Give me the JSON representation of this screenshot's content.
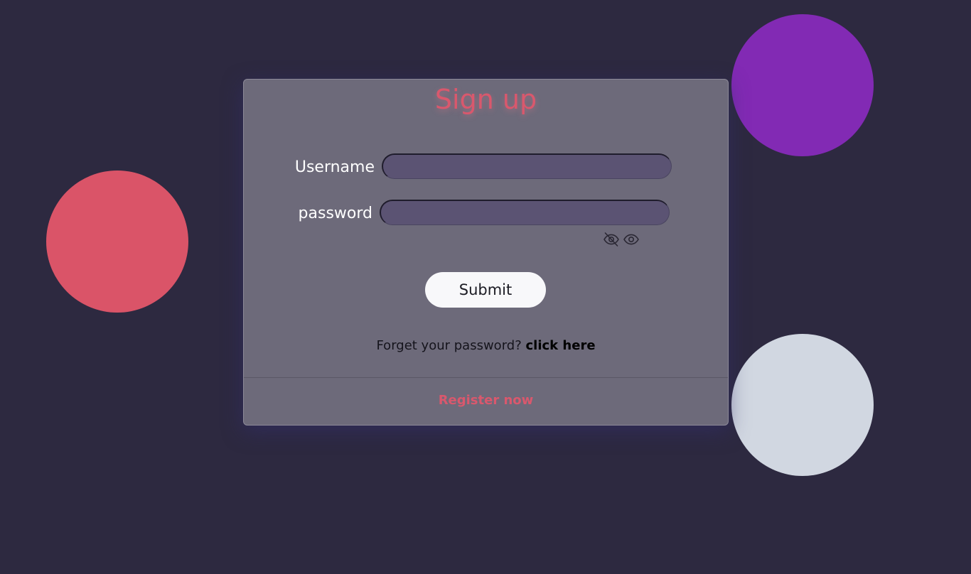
{
  "form": {
    "title": "Sign up",
    "username_label": "Username",
    "username_value": "",
    "password_label": "password",
    "password_value": "",
    "hide_password_icon": "eye-slash-icon",
    "show_password_icon": "eye-icon",
    "submit_label": "Submit",
    "forgot_text": "Forget your password?",
    "forgot_link": "click here",
    "register_link": "Register now"
  },
  "colors": {
    "background": "#2d2940",
    "card": "#6d6a7a",
    "accent_pink": "#d9586d",
    "circle_pink": "#da5468",
    "circle_purple": "#822ab4",
    "circle_light": "#d1d7e1",
    "input_fill": "#5b5373"
  }
}
